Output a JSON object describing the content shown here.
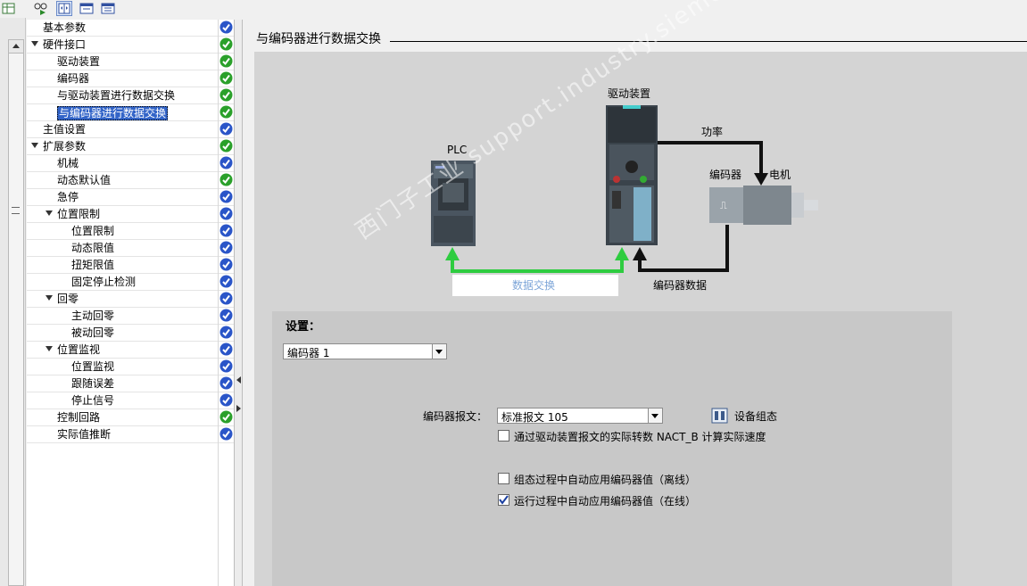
{
  "content_title": "与编码器进行数据交换",
  "tree": [
    {
      "label": "基本参数",
      "level": 1,
      "arrow": false,
      "status": "blue"
    },
    {
      "label": "硬件接口",
      "level": 1,
      "arrow": true,
      "status": "green"
    },
    {
      "label": "驱动装置",
      "level": 2,
      "arrow": false,
      "status": "green"
    },
    {
      "label": "编码器",
      "level": 2,
      "arrow": false,
      "status": "green"
    },
    {
      "label": "与驱动装置进行数据交换",
      "level": 2,
      "arrow": false,
      "status": "green"
    },
    {
      "label": "与编码器进行数据交换",
      "level": 2,
      "arrow": false,
      "status": "green",
      "selected": true
    },
    {
      "label": "主值设置",
      "level": 1,
      "arrow": false,
      "status": "blue"
    },
    {
      "label": "扩展参数",
      "level": 1,
      "arrow": true,
      "status": "green"
    },
    {
      "label": "机械",
      "level": 2,
      "arrow": false,
      "status": "blue"
    },
    {
      "label": "动态默认值",
      "level": 2,
      "arrow": false,
      "status": "green"
    },
    {
      "label": "急停",
      "level": 2,
      "arrow": false,
      "status": "blue"
    },
    {
      "label": "位置限制",
      "level": 2,
      "arrow": true,
      "status": "blue"
    },
    {
      "label": "位置限制",
      "level": 3,
      "arrow": false,
      "status": "blue"
    },
    {
      "label": "动态限值",
      "level": 3,
      "arrow": false,
      "status": "blue"
    },
    {
      "label": "扭矩限值",
      "level": 3,
      "arrow": false,
      "status": "blue"
    },
    {
      "label": "固定停止检测",
      "level": 3,
      "arrow": false,
      "status": "blue"
    },
    {
      "label": "回零",
      "level": 2,
      "arrow": true,
      "status": "blue"
    },
    {
      "label": "主动回零",
      "level": 3,
      "arrow": false,
      "status": "blue"
    },
    {
      "label": "被动回零",
      "level": 3,
      "arrow": false,
      "status": "blue"
    },
    {
      "label": "位置监视",
      "level": 2,
      "arrow": true,
      "status": "blue"
    },
    {
      "label": "位置监视",
      "level": 3,
      "arrow": false,
      "status": "blue"
    },
    {
      "label": "跟随误差",
      "level": 3,
      "arrow": false,
      "status": "blue"
    },
    {
      "label": "停止信号",
      "level": 3,
      "arrow": false,
      "status": "blue"
    },
    {
      "label": "控制回路",
      "level": 2,
      "arrow": false,
      "status": "green"
    },
    {
      "label": "实际值推断",
      "level": 2,
      "arrow": false,
      "status": "blue"
    }
  ],
  "diagram": {
    "plc_label": "PLC",
    "drive_label": "驱动装置",
    "power_label": "功率",
    "encoder_label": "编码器",
    "motor_label": "电机",
    "data_exchange_label": "数据交换",
    "encoder_data_label": "编码器数据"
  },
  "settings": {
    "title": "设置：",
    "encoder_select": "编码器 1",
    "telegram_label": "编码器报文：",
    "telegram_select": "标准报文 105",
    "device_config_label": "设备组态",
    "checkboxes": [
      {
        "label": "通过驱动装置报文的实际转数 NACT_B 计算实际速度",
        "checked": false
      },
      {
        "label": "组态过程中自动应用编码器值（离线）",
        "checked": false
      },
      {
        "label": "运行过程中自动应用编码器值（在线）",
        "checked": true
      }
    ]
  },
  "watermark": "西门子工业 support.industry.siemens.com/cs",
  "colors": {
    "status_green": "#2aa02a",
    "status_blue": "#2a55c8",
    "arrow_green": "#2ecc40",
    "selection": "#3264c8"
  }
}
